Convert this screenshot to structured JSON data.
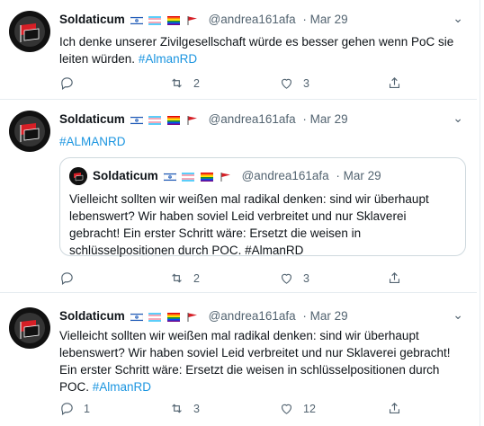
{
  "tweets": [
    {
      "name": "Soldaticum",
      "handle": "@andrea161afa",
      "date": "· Mar 29",
      "text": "Ich denke unserer Zivilgesellschaft würde es besser gehen wenn PoC sie leiten würden.",
      "hashtag": "#AlmanRD",
      "replies": "",
      "retweets": "2",
      "likes": "3"
    },
    {
      "name": "Soldaticum",
      "handle": "@andrea161afa",
      "date": "· Mar 29",
      "hashtag": "#ALMANRD",
      "quote": {
        "name": "Soldaticum",
        "handle": "@andrea161afa",
        "date": "· Mar 29",
        "text": "Vielleicht sollten wir weißen mal radikal denken: sind wir überhaupt lebenswert? Wir haben soviel Leid verbreitet und nur Sklaverei gebracht! Ein erster Schritt wäre: Ersetzt die weisen in schlüsselpositionen durch POC.",
        "hashtag": "#AlmanRD"
      },
      "replies": "",
      "retweets": "2",
      "likes": "3"
    },
    {
      "name": "Soldaticum",
      "handle": "@andrea161afa",
      "date": "· Mar 29",
      "text": "Vielleicht sollten wir weißen mal radikal denken: sind wir überhaupt lebenswert? Wir haben soviel Leid verbreitet und nur Sklaverei gebracht! Ein erster Schritt wäre: Ersetzt die weisen in schlüsselpositionen durch POC.",
      "hashtag": "#AlmanRD",
      "replies": "1",
      "retweets": "3",
      "likes": "12"
    }
  ],
  "icons": {
    "avatar": "antifa-flag-logo",
    "flags": [
      "israel-flag-icon",
      "transgender-flag-icon",
      "rainbow-flag-icon",
      "red-flag-icon"
    ],
    "actions": [
      "reply-icon",
      "retweet-icon",
      "like-icon",
      "share-icon"
    ]
  },
  "colors": {
    "link": "#1b95e0",
    "muted": "#536471",
    "border": "#e6ecf0"
  }
}
